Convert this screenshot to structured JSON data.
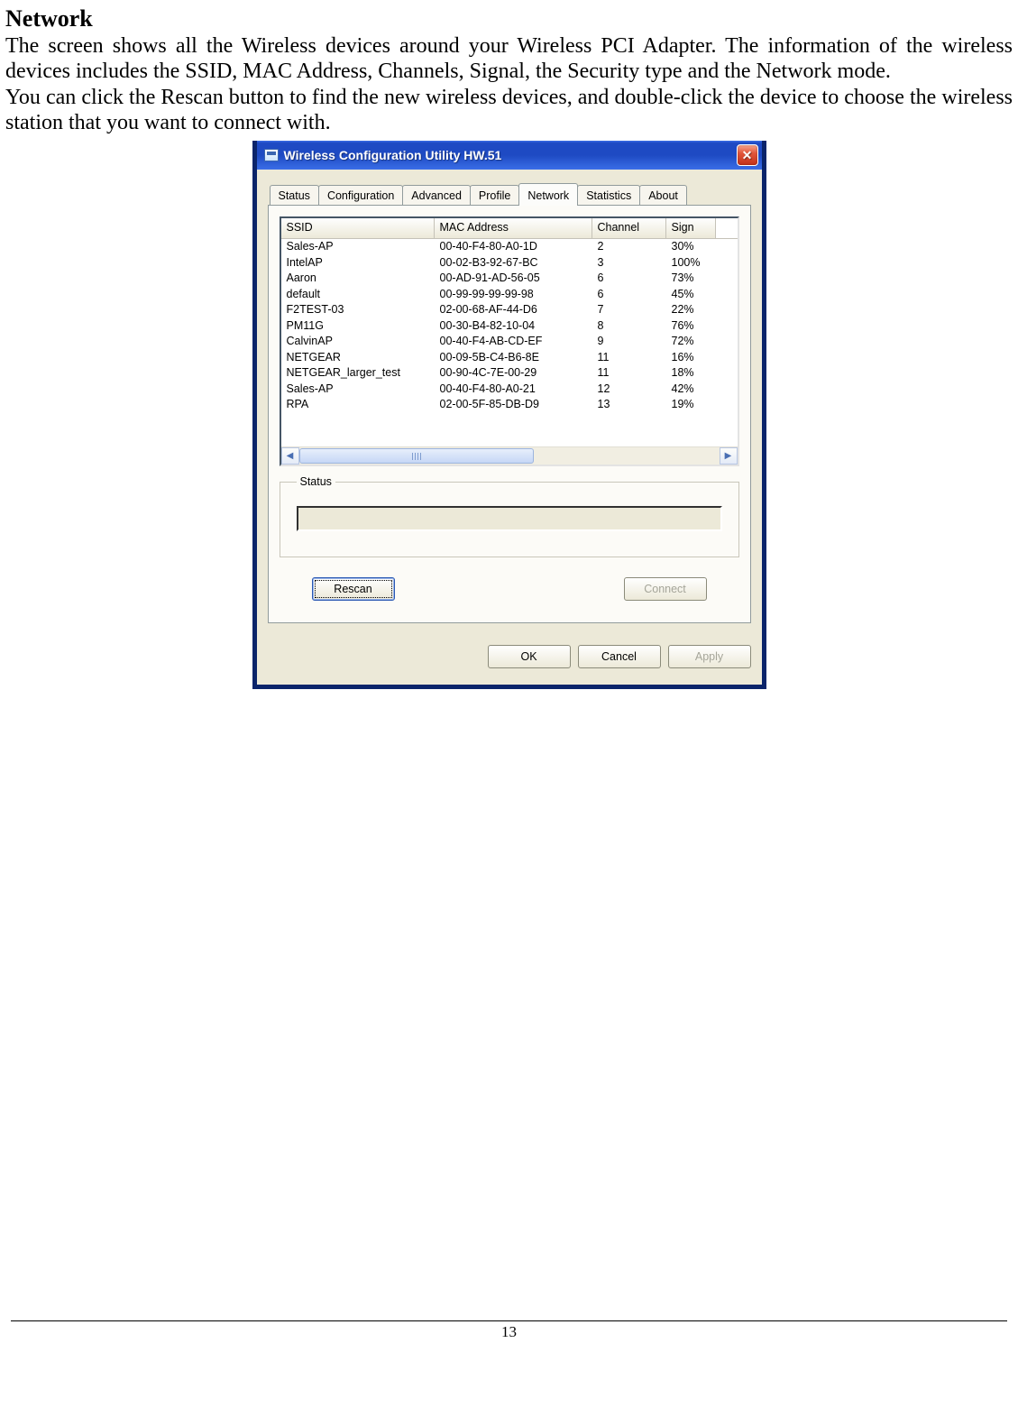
{
  "doc": {
    "heading": "Network",
    "para1": "The screen shows all the Wireless devices around your Wireless PCI Adapter. The information of the wireless devices includes the SSID, MAC Address, Channels, Signal, the Security type and the Network mode.",
    "para2": "You can click the Rescan button to find the new wireless devices, and double-click the device to choose the wireless station that you want to connect with.",
    "page_number": "13"
  },
  "dialog": {
    "title": "Wireless Configuration Utility HW.51",
    "tabs": [
      "Status",
      "Configuration",
      "Advanced",
      "Profile",
      "Network",
      "Statistics",
      "About"
    ],
    "active_tab_index": 4,
    "columns": {
      "ssid": "SSID",
      "mac": "MAC Address",
      "channel": "Channel",
      "signal": "Sign"
    },
    "rows": [
      {
        "ssid": "Sales-AP",
        "mac": "00-40-F4-80-A0-1D",
        "channel": "2",
        "signal": "30%"
      },
      {
        "ssid": "IntelAP",
        "mac": "00-02-B3-92-67-BC",
        "channel": "3",
        "signal": "100%"
      },
      {
        "ssid": "Aaron",
        "mac": "00-AD-91-AD-56-05",
        "channel": "6",
        "signal": "73%"
      },
      {
        "ssid": "default",
        "mac": "00-99-99-99-99-98",
        "channel": "6",
        "signal": "45%"
      },
      {
        "ssid": "F2TEST-03",
        "mac": "02-00-68-AF-44-D6",
        "channel": "7",
        "signal": "22%"
      },
      {
        "ssid": "PM11G",
        "mac": "00-30-B4-82-10-04",
        "channel": "8",
        "signal": "76%"
      },
      {
        "ssid": "CalvinAP",
        "mac": "00-40-F4-AB-CD-EF",
        "channel": "9",
        "signal": "72%"
      },
      {
        "ssid": "NETGEAR",
        "mac": "00-09-5B-C4-B6-8E",
        "channel": "11",
        "signal": "16%"
      },
      {
        "ssid": "NETGEAR_larger_test",
        "mac": "00-90-4C-7E-00-29",
        "channel": "11",
        "signal": "18%"
      },
      {
        "ssid": "Sales-AP",
        "mac": "00-40-F4-80-A0-21",
        "channel": "12",
        "signal": "42%"
      },
      {
        "ssid": "RPA",
        "mac": "02-00-5F-85-DB-D9",
        "channel": "13",
        "signal": "19%"
      }
    ],
    "status_label": "Status",
    "status_text": "",
    "buttons": {
      "rescan": "Rescan",
      "connect": "Connect",
      "ok": "OK",
      "cancel": "Cancel",
      "apply": "Apply"
    }
  }
}
